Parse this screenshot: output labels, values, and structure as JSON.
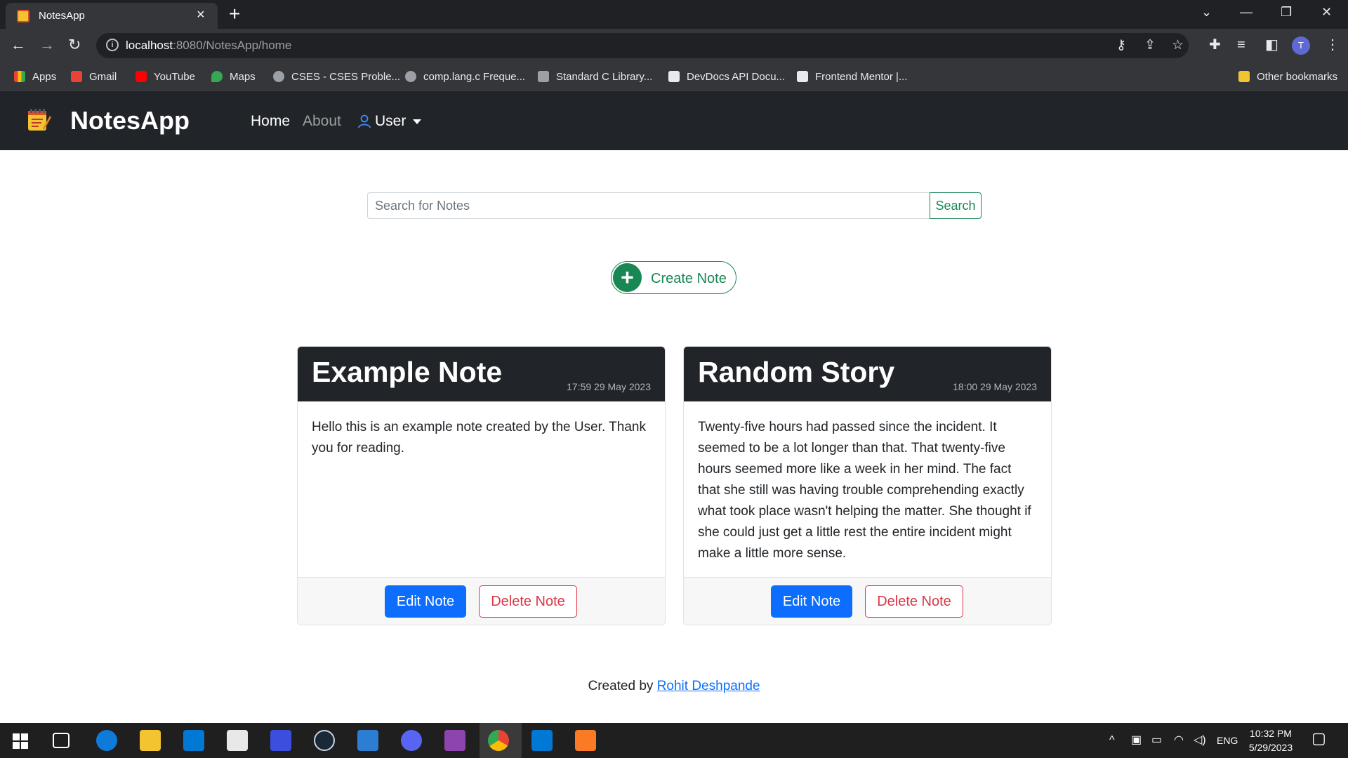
{
  "browser": {
    "tab_title": "NotesApp",
    "url_host": "localhost",
    "url_path": ":8080/NotesApp/home",
    "bookmarks": [
      {
        "label": "Apps",
        "color": "#ea4335"
      },
      {
        "label": "Gmail",
        "color": "#ea4335"
      },
      {
        "label": "YouTube",
        "color": "#ff0000"
      },
      {
        "label": "Maps",
        "color": "#34a853"
      },
      {
        "label": "CSES - CSES Proble...",
        "color": "#9aa0a6"
      },
      {
        "label": "comp.lang.c Freque...",
        "color": "#9aa0a6"
      },
      {
        "label": "Standard C Library...",
        "color": "#9aa0a6"
      },
      {
        "label": "DevDocs API Docu...",
        "color": "#e8eaed"
      },
      {
        "label": "Frontend Mentor |...",
        "color": "#e8eaed"
      }
    ],
    "other_bookmarks": "Other bookmarks",
    "profile_initial": "T"
  },
  "navbar": {
    "brand": "NotesApp",
    "links": {
      "home": "Home",
      "about": "About",
      "user": "User"
    }
  },
  "search": {
    "placeholder": "Search for Notes",
    "button": "Search"
  },
  "create_note": {
    "label": "Create Note"
  },
  "notes": [
    {
      "title": "Example Note",
      "date": "17:59 29 May 2023",
      "body": "Hello this is an example note created by the User. Thank you for reading.",
      "edit": "Edit Note",
      "delete": "Delete Note"
    },
    {
      "title": "Random Story",
      "date": "18:00 29 May 2023",
      "body": "Twenty-five hours had passed since the incident. It seemed to be a lot longer than that. That twenty-five hours seemed more like a week in her mind. The fact that she still was having trouble comprehending exactly what took place wasn't helping the matter. She thought if she could just get a little rest the entire incident might make a little more sense.",
      "edit": "Edit Note",
      "delete": "Delete Note"
    }
  ],
  "footer": {
    "prefix": "Created by",
    "author": "Rohit Deshpande"
  },
  "taskbar": {
    "language": "ENG",
    "time": "10:32 PM",
    "date": "5/29/2023"
  },
  "colors": {
    "navbar_bg": "#212529",
    "success": "#198754",
    "primary": "#0d6efd",
    "danger": "#dc3545"
  }
}
